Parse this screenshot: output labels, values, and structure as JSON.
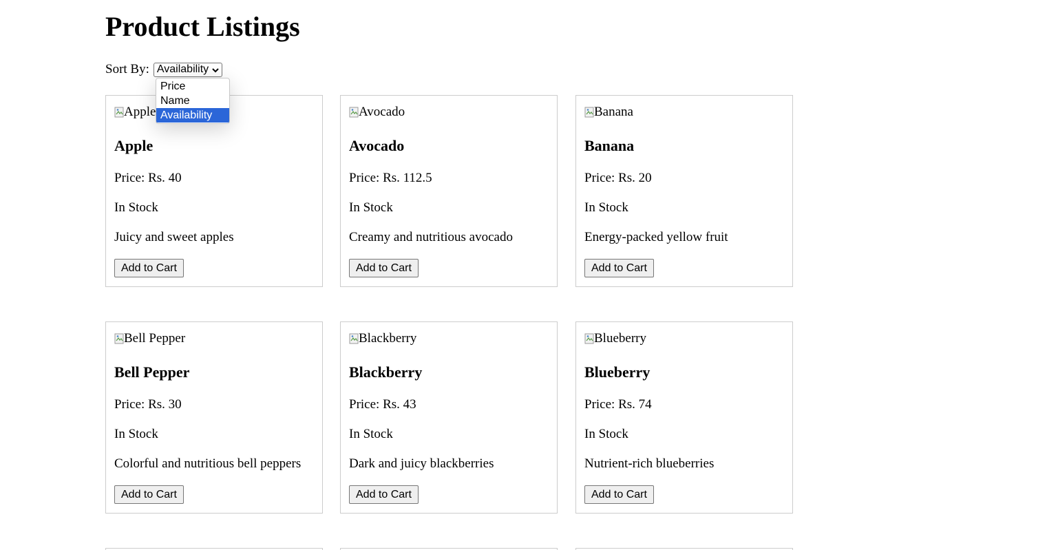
{
  "page": {
    "title": "Product Listings"
  },
  "sort": {
    "label": "Sort By:",
    "selected": "Availability",
    "options": [
      "Price",
      "Name",
      "Availability"
    ],
    "highlight_color": "#2b66d8"
  },
  "products": [
    {
      "img_alt": "Apple",
      "name": "Apple",
      "price": "Price: Rs. 40",
      "stock": "In Stock",
      "desc": "Juicy and sweet apples",
      "button": "Add to Cart"
    },
    {
      "img_alt": "Avocado",
      "name": "Avocado",
      "price": "Price: Rs. 112.5",
      "stock": "In Stock",
      "desc": "Creamy and nutritious avocado",
      "button": "Add to Cart"
    },
    {
      "img_alt": "Banana",
      "name": "Banana",
      "price": "Price: Rs. 20",
      "stock": "In Stock",
      "desc": "Energy-packed yellow fruit",
      "button": "Add to Cart"
    },
    {
      "img_alt": "Bell Pepper",
      "name": "Bell Pepper",
      "price": "Price: Rs. 30",
      "stock": "In Stock",
      "desc": "Colorful and nutritious bell peppers",
      "button": "Add to Cart"
    },
    {
      "img_alt": "Blackberry",
      "name": "Blackberry",
      "price": "Price: Rs. 43",
      "stock": "In Stock",
      "desc": "Dark and juicy blackberries",
      "button": "Add to Cart"
    },
    {
      "img_alt": "Blueberry",
      "name": "Blueberry",
      "price": "Price: Rs. 74",
      "stock": "In Stock",
      "desc": "Nutrient-rich blueberries",
      "button": "Add to Cart"
    }
  ],
  "icons": {
    "broken_image": "broken-image-icon",
    "dropdown_chevron": "chevron-down-icon"
  }
}
